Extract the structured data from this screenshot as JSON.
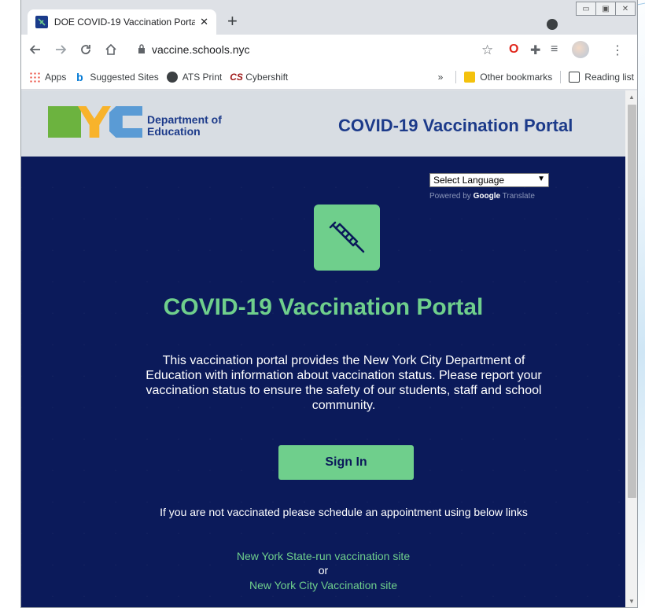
{
  "browser": {
    "tab_title": "DOE COVID-19 Vaccination Porta",
    "tab_close": "✕",
    "new_tab": "+",
    "url": "vaccine.schools.nyc",
    "win_min": "▭",
    "win_max": "▣",
    "win_close": "✕"
  },
  "bookmarks": {
    "items": [
      "Apps",
      "Suggested Sites",
      "ATS Print",
      "Cybershift"
    ],
    "overflow": "»",
    "other": "Other bookmarks",
    "reading_list": "Reading list"
  },
  "header": {
    "logo_line1": "Department of",
    "logo_line2": "Education",
    "title": "COVID-19 Vaccination Portal"
  },
  "hero": {
    "language_select": "Select Language",
    "powered_by": "Powered by ",
    "google": "Google",
    "translate": " Translate",
    "title": "COVID-19 Vaccination Portal",
    "description": "This vaccination portal provides the New York City Department of Education with information about vaccination status. Please report your vaccination status to ensure the safety of our students, staff and school community.",
    "signin_label": "Sign In",
    "not_vaccinated": "If you are not vaccinated please schedule an appointment using below links",
    "link_nys": "New York State-run vaccination site",
    "or": "or",
    "link_nyc": "New York City Vaccination site"
  },
  "colors": {
    "hero_bg": "#0b1a5a",
    "accent_green": "#6fcf8c",
    "header_bg": "#d8dde3",
    "header_title": "#1c3a8a"
  }
}
